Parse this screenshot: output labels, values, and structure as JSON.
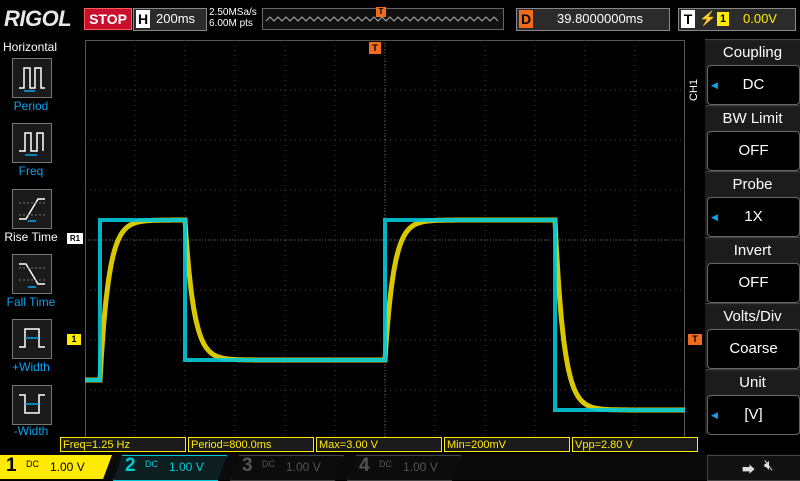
{
  "topbar": {
    "brand": "RIGOL",
    "run_state": "STOP",
    "horizontal": {
      "tag": "H",
      "timebase": "200ms"
    },
    "sample_rate": "2.50MSa/s",
    "memory_depth": "6.00M pts",
    "trigger_position_tag": "T",
    "delay": {
      "tag": "D",
      "value": "39.8000000ms"
    },
    "trigger": {
      "tag": "T",
      "edge_icon": "rising-edge-icon",
      "source": "1",
      "level": "0.00V"
    }
  },
  "left_menu": {
    "title": "Horizontal",
    "items": [
      {
        "label": "Period",
        "icon": "period-icon"
      },
      {
        "label": "Freq",
        "icon": "freq-icon"
      },
      {
        "label": "Rise Time",
        "icon": "rise-time-icon"
      },
      {
        "label": "Fall Time",
        "icon": "fall-time-icon"
      },
      {
        "label": "+Width",
        "icon": "pos-width-icon"
      },
      {
        "label": "-Width",
        "icon": "neg-width-icon"
      }
    ]
  },
  "right_menu": {
    "channel_tab": "CH1",
    "items": [
      {
        "title": "Coupling",
        "value": "DC"
      },
      {
        "title": "BW Limit",
        "value": "OFF"
      },
      {
        "title": "Probe",
        "value": "1X"
      },
      {
        "title": "Invert",
        "value": "OFF"
      },
      {
        "title": "Volts/Div",
        "value": "Coarse"
      },
      {
        "title": "Unit",
        "value": "[V]"
      }
    ]
  },
  "markers": {
    "ref_marker": "R1",
    "ch1_marker": "1",
    "trigger_level_marker": "T"
  },
  "measurements": {
    "freq": "Freq=1.25 Hz",
    "period": "Period=800.0ms",
    "max": "Max=3.00 V",
    "min": "Min=200mV",
    "vpp": "Vpp=2.80 V"
  },
  "channels": [
    {
      "num": "1",
      "coupling": "DC",
      "scale": "1.00 V",
      "color": "#ffeb00",
      "active": true
    },
    {
      "num": "2",
      "coupling": "DC",
      "scale": "1.00 V",
      "color": "#00c8d8",
      "active": true
    },
    {
      "num": "3",
      "coupling": "DC",
      "scale": "1.00 V",
      "color": "#c000c0",
      "active": false
    },
    {
      "num": "4",
      "coupling": "DC",
      "scale": "1.00 V",
      "color": "#2a6fd6",
      "active": false
    }
  ],
  "status_icons": {
    "usb": "usb-icon",
    "sound": "speaker-muted-icon"
  },
  "colors": {
    "ch1": "#ffeb00",
    "ch2": "#00c8d8",
    "accent": "#0aa2f0",
    "trigger": "#f26b1d",
    "stop": "#c8102e"
  },
  "chart_data": {
    "type": "line",
    "x_unit": "s",
    "y_unit": "V",
    "time_per_div": 0.2,
    "volts_per_div": 1.0,
    "grid": true,
    "series": [
      {
        "name": "1",
        "color": "#ffeb00",
        "style": "step-response",
        "x": [
          -1.2,
          -1.14,
          -1.09,
          -0.8,
          -0.38,
          0.0,
          0.2,
          0.68,
          0.88,
          1.2
        ],
        "y": [
          -0.4,
          -0.4,
          1.2,
          1.2,
          -0.2,
          -0.2,
          1.2,
          1.2,
          -0.7,
          -0.7
        ]
      },
      {
        "name": "2",
        "color": "#00c8d8",
        "style": "step",
        "x": [
          -1.2,
          -1.14,
          -0.8,
          -0.38,
          0.0,
          0.2,
          0.68,
          0.88,
          1.2
        ],
        "y": [
          -0.4,
          1.2,
          -0.2,
          -0.2,
          1.2,
          1.2,
          -0.7,
          -0.7,
          -0.7
        ]
      }
    ]
  }
}
